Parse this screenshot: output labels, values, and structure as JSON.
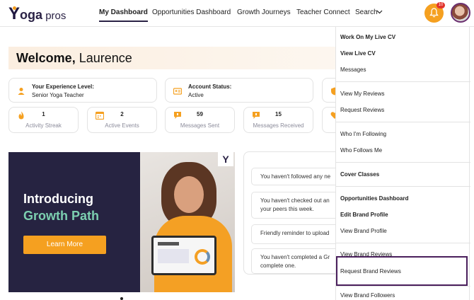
{
  "header": {
    "logo_text_y": "Y",
    "logo_text_oga": "oga",
    "logo_text_pros": " pros",
    "nav": [
      "My Dashboard",
      "Opportunities Dashboard",
      "Growth Journeys",
      "Teacher Connect",
      "Search"
    ],
    "notification_count": "10",
    "icons": {
      "bell": "bell-icon",
      "chevron": "chevron-down-icon"
    }
  },
  "welcome": {
    "greeting": "Welcome,",
    "name": "Laurence"
  },
  "info_cards": [
    {
      "label": "Your Experience Level:",
      "value": "Senior Yoga Teacher",
      "icon": "person-icon"
    },
    {
      "label": "Account Status:",
      "value": "Active",
      "icon": "id-card-icon"
    },
    {
      "icon": "shield-icon"
    }
  ],
  "stats": [
    {
      "value": "1",
      "label": "Activity Streak",
      "icon": "flame-icon"
    },
    {
      "value": "2",
      "label": "Active Events",
      "icon": "calendar-icon"
    },
    {
      "value": "59",
      "label": "Messages Sent",
      "icon": "message-icon"
    },
    {
      "value": "15",
      "label": "Messages Received",
      "icon": "message-icon"
    },
    {
      "icon": "heart-icon"
    }
  ],
  "promo": {
    "line1": "Introducing",
    "line2": "Growth Path",
    "button": "Learn More",
    "corner_logo": "Y"
  },
  "reminders": [
    "You haven't followed any ne",
    "You haven't checked out an",
    "your peers this week.",
    "Friendly reminder to upload",
    "You haven't completed a Gr",
    "complete one."
  ],
  "menu": {
    "items": [
      {
        "label": "Work On My Live CV",
        "bold": true
      },
      {
        "label": "View Live CV",
        "bold": true
      },
      {
        "label": "Messages",
        "bold": false
      },
      {
        "label": "View My Reviews",
        "bold": false
      },
      {
        "label": "Request Reviews",
        "bold": false
      },
      {
        "label": "Who I'm Following",
        "bold": false
      },
      {
        "label": "Who Follows Me",
        "bold": false
      },
      {
        "label": "Cover Classes",
        "bold": true
      },
      {
        "label": "Opportunities Dashboard",
        "bold": true
      },
      {
        "label": "Edit Brand Profile",
        "bold": true
      },
      {
        "label": "View Brand Profile",
        "bold": false
      },
      {
        "label": "View Brand Reviews",
        "bold": false
      },
      {
        "label": "Request Brand Reviews",
        "bold": false
      },
      {
        "label": "View Brand Followers",
        "bold": false
      }
    ]
  },
  "colors": {
    "accent": "#f5a020",
    "brand": "#2a2245",
    "highlight": "#4a1f5c",
    "growth": "#7ccfb0"
  }
}
